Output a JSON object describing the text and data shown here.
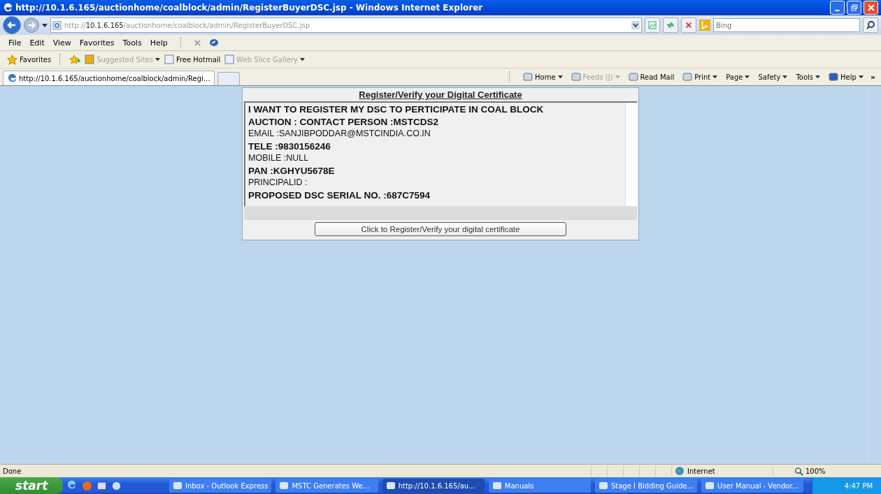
{
  "window": {
    "title": "http://10.1.6.165/auctionhome/coalblock/admin/RegisterBuyerDSC.jsp - Windows Internet Explorer"
  },
  "address_bar": {
    "host_prefix": "http://",
    "host": "10.1.6.165",
    "path": "/auctionhome/coalblock/admin/RegisterBuyerDSC.jsp"
  },
  "search": {
    "placeholder": "Bing"
  },
  "menu": [
    "File",
    "Edit",
    "View",
    "Favorites",
    "Tools",
    "Help"
  ],
  "favorites_bar": {
    "label": "Favorites",
    "links": [
      {
        "label": "Suggested Sites",
        "disabled": true,
        "dropdown": true
      },
      {
        "label": "Free Hotmail",
        "disabled": false,
        "dropdown": false
      },
      {
        "label": "Web Slice Gallery",
        "disabled": true,
        "dropdown": true
      }
    ]
  },
  "tabs": [
    {
      "label": "http://10.1.6.165/auctionhome/coalblock/admin/Regi...",
      "selected": true
    }
  ],
  "command_bar": [
    {
      "label": "Home",
      "disabled": false,
      "dropdown": true
    },
    {
      "label": "Feeds (J)",
      "disabled": true,
      "dropdown": true
    },
    {
      "label": "Read Mail",
      "disabled": false,
      "dropdown": false
    },
    {
      "label": "Print",
      "disabled": false,
      "dropdown": true
    },
    {
      "label": "Page",
      "disabled": false,
      "dropdown": true
    },
    {
      "label": "Safety",
      "disabled": false,
      "dropdown": true
    },
    {
      "label": "Tools",
      "disabled": false,
      "dropdown": true
    },
    {
      "label": "Help",
      "disabled": false,
      "dropdown": true
    }
  ],
  "overflow_chevron": "»",
  "panel": {
    "title": "Register/Verify your Digital Certificate",
    "lines": [
      {
        "text": "I WANT TO REGISTER MY DSC TO PERTICIPATE IN COAL BLOCK",
        "bold": true
      },
      {
        "text": "AUCTION : CONTACT PERSON :MSTCDS2",
        "bold": true
      },
      {
        "text": "EMAIL :SANJIBPODDAR@MSTCINDIA.CO.IN",
        "bold": false
      },
      {
        "text": "TELE :9830156246",
        "bold": true
      },
      {
        "text": "MOBILE :NULL",
        "bold": false
      },
      {
        "text": "PAN :KGHYU5678E",
        "bold": true
      },
      {
        "text": "PRINCIPALID :",
        "bold": false
      },
      {
        "text": "PROPOSED DSC SERIAL NO. :687C7594",
        "bold": true
      }
    ],
    "button": "Click to Register/Verify your digital certificate"
  },
  "status_bar": {
    "text": "Done",
    "zone": "Internet",
    "zoom": "100%"
  },
  "taskbar": {
    "start": "start",
    "tasks": [
      {
        "label": "Inbox - Outlook Express",
        "selected": false
      },
      {
        "label": "MSTC Generates We...",
        "selected": false
      },
      {
        "label": "http://10.1.6.165/au...",
        "selected": true
      },
      {
        "label": "Manuals",
        "selected": false
      },
      {
        "label": "Stage I Bidding Guide...",
        "selected": false
      },
      {
        "label": "User Manual - Vendor...",
        "selected": false
      }
    ],
    "clock": "4:47 PM"
  }
}
